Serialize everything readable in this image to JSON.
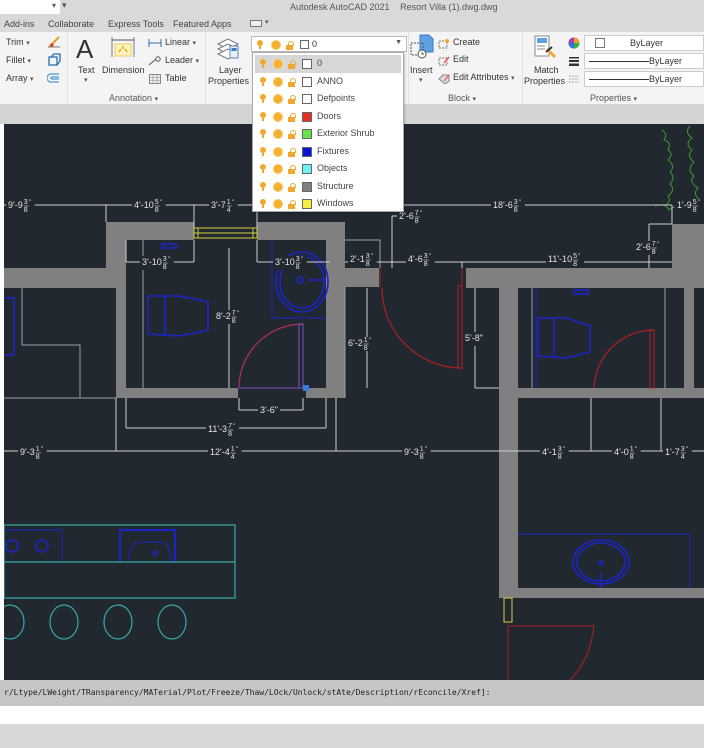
{
  "titlebar": {
    "app": "Autodesk AutoCAD 2021",
    "file": "Resort Villa (1).dwg.dwg"
  },
  "tabs": [
    "Add-ins",
    "Collaborate",
    "Express Tools",
    "Featured Apps"
  ],
  "ribbon": {
    "modify": {
      "trim": "Trim",
      "fillet": "Fillet",
      "array": "Array"
    },
    "annotation": {
      "text": "Text",
      "dimension": "Dimension",
      "linear": "Linear",
      "leader": "Leader",
      "table": "Table",
      "group_label": "Annotation"
    },
    "layers": {
      "layer_properties_1": "Layer",
      "layer_properties_2": "Properties",
      "current_layer": "0"
    },
    "block": {
      "insert": "Insert",
      "create": "Create",
      "edit": "Edit",
      "edit_attributes": "Edit Attributes",
      "group_label": "Block"
    },
    "properties": {
      "match_1": "Match",
      "match_2": "Properties",
      "color": "ByLayer",
      "linetype": "ByLayer",
      "lineweight": "ByLayer",
      "group_label": "Properties"
    }
  },
  "layer_dropdown": {
    "selected": "0",
    "items": [
      {
        "name": "0",
        "color": "#ffffff"
      },
      {
        "name": "ANNO",
        "color": "#ffffff"
      },
      {
        "name": "Defpoints",
        "color": "#ffffff"
      },
      {
        "name": "Doors",
        "color": "#e53027"
      },
      {
        "name": "Exterior Shrub",
        "color": "#66e24a"
      },
      {
        "name": "Fixtures",
        "color": "#0a14d9"
      },
      {
        "name": "Objects",
        "color": "#6ef0f0"
      },
      {
        "name": "Structure",
        "color": "#808080"
      },
      {
        "name": "Windows",
        "color": "#f5f040"
      }
    ]
  },
  "drawing": {
    "dimensions": {
      "top_1": "9'-9",
      "top_1_num": "3",
      "top_1_den": "8",
      "top_2": "4'-10",
      "top_2_num": "5",
      "top_2_den": "8",
      "top_3": "3'-7",
      "top_3_num": "1",
      "top_3_den": "4",
      "top_4": "18'-6",
      "top_4_num": "3",
      "top_4_den": "8",
      "top_5": "1'-9",
      "top_5_num": "5",
      "top_5_den": "8",
      "r2_1": "3'-10",
      "r2_1_num": "3",
      "r2_1_den": "8",
      "r2_2": "3'-10",
      "r2_2_num": "3",
      "r2_2_den": "8",
      "r2_3": "2'-1",
      "r2_3_num": "3",
      "r2_3_den": "8",
      "r2_4": "4'-6",
      "r2_4_num": "3",
      "r2_4_den": "8",
      "r2_5": "11'-10",
      "r2_5_num": "5",
      "r2_5_den": "8",
      "v_1": "2'-6",
      "v_1_num": "7",
      "v_1_den": "8",
      "v_2": "2'-6",
      "v_2_num": "7",
      "v_2_den": "8",
      "v_3": "8'-2",
      "v_3_num": "7",
      "v_3_den": "8",
      "v_4": "6'-2",
      "v_4_num": "1",
      "v_4_den": "8",
      "v_5": "5'-8\"",
      "door": "3'-6\"",
      "mid": "11'-3",
      "mid_num": "7",
      "mid_den": "8",
      "b_1": "9'-3",
      "b_1_num": "1",
      "b_1_den": "8",
      "b_2": "12'-4",
      "b_2_num": "1",
      "b_2_den": "4",
      "b_3": "9'-3",
      "b_3_num": "1",
      "b_3_den": "8",
      "b_4": "4'-1",
      "b_4_num": "3",
      "b_4_den": "8",
      "b_5": "4'-0",
      "b_5_num": "1",
      "b_5_den": "8",
      "b_6": "1'-7",
      "b_6_num": "3",
      "b_6_den": "4"
    }
  },
  "command_line": {
    "text": "r/Ltype/LWeight/TRansparency/MATerial/Plot/Freeze/Thaw/LOck/Unlock/stAte/Description/rEconcile/Xref]:"
  }
}
